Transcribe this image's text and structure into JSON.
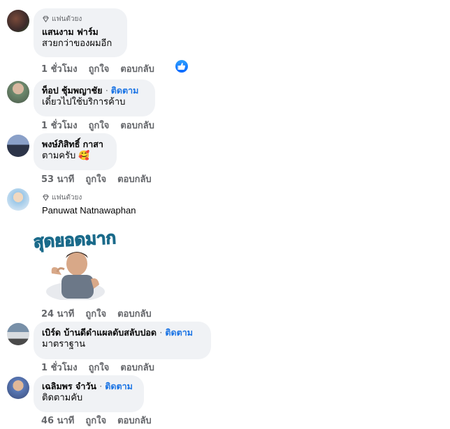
{
  "comments": [
    {
      "badge": "แฟนตัวยง",
      "name": "แสนงาม ฟาร์ม",
      "follow": "",
      "text": "สวยกว่าของผมอีก",
      "time": "1 ชั่วโมง",
      "like": "ถูกใจ",
      "reply": "ตอบกลับ",
      "has_reaction": true
    },
    {
      "badge": "",
      "name": "ท็อป ชุ้มพญาชัย",
      "follow": "ติดตาม",
      "text": "เดี๋ยวไปใช้บริการค้าบ",
      "time": "1 ชั่วโมง",
      "like": "ถูกใจ",
      "reply": "ตอบกลับ"
    },
    {
      "badge": "",
      "name": "พงษ์ภิสิทธิ์ กาสา",
      "follow": "",
      "text": "ตามครับ 🥰",
      "time": "53 นาที",
      "like": "ถูกใจ",
      "reply": "ตอบกลับ"
    },
    {
      "badge": "แฟนตัวยง",
      "name": "Panuwat Natnawaphan",
      "follow": "",
      "text": "",
      "sticker_text": "สุดยอดมาก",
      "time": "24 นาที",
      "like": "ถูกใจ",
      "reply": "ตอบกลับ"
    },
    {
      "badge": "",
      "name": "เบิร์ด บ้านดีดำแผลดับสลับปอด",
      "follow": "ติดตาม",
      "text": "มาตราฐาน",
      "time": "1 ชั่วโมง",
      "like": "ถูกใจ",
      "reply": "ตอบกลับ"
    },
    {
      "badge": "",
      "name": "เฉลิมพร จำวัน",
      "follow": "ติดตาม",
      "text": "ติดตามคับ",
      "time": "46 นาที",
      "like": "ถูกใจ",
      "reply": "ตอบกลับ"
    }
  ],
  "colors": {
    "follow": "#1b74e4",
    "bubble": "#f0f2f5",
    "meta": "#65676b",
    "reaction": "#0866ff"
  },
  "icons": {
    "badge": "diamond-icon",
    "reaction": "thumbs-up-icon"
  }
}
